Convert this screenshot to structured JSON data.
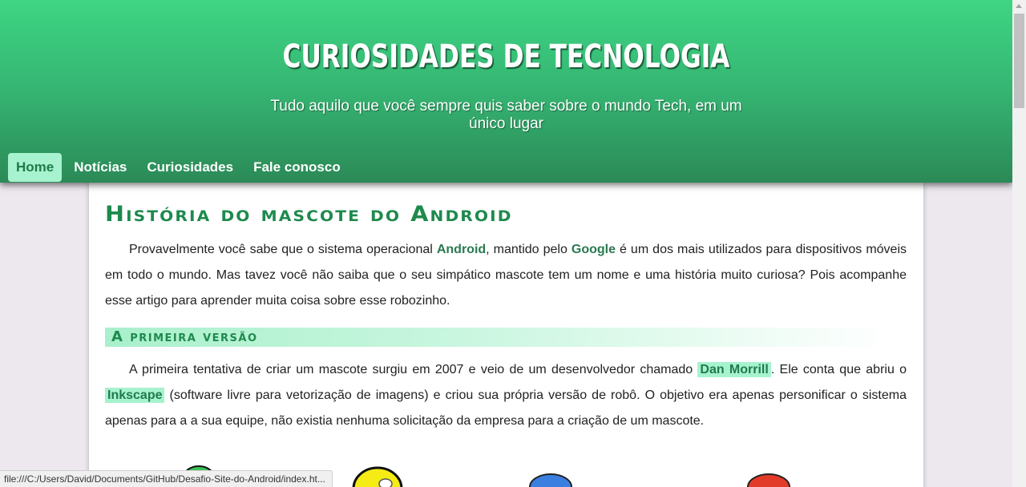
{
  "header": {
    "title": "CURIOSIDADES DE TECNOLOGIA",
    "subtitle": "Tudo aquilo que você sempre quis saber sobre o mundo Tech, em um único lugar"
  },
  "nav": {
    "items": [
      {
        "label": "Home",
        "active": true
      },
      {
        "label": "Notícias",
        "active": false
      },
      {
        "label": "Curiosidades",
        "active": false
      },
      {
        "label": "Fale conosco",
        "active": false
      }
    ]
  },
  "article": {
    "title": "História do mascote do Android",
    "intro": {
      "t1": "Provavelmente você sabe que o sistema operacional ",
      "android": "Android",
      "t2": ", mantido pelo ",
      "google": "Google",
      "t3": " é um dos mais utilizados para dispositivos móveis em todo o mundo. Mas tavez você não saiba que o seu simpático mascote tem um nome e uma história muito curiosa? Pois acompanhe esse artigo para aprender muita coisa sobre esse robozinho."
    },
    "section1": {
      "title": "A primeira versão",
      "t1": "A primeira tentativa de criar um mascote surgiu em 2007 e veio de um desenvolvedor chamado ",
      "dan": "Dan Morrill",
      "t2": ". Ele conta que abriu o ",
      "inkscape": "Inkscape",
      "t3": " (software livre para vetorização de imagens) e criou sua própria versão de robô. O objetivo era apenas personificar o sistema apenas para a a sua equipe, não existia nenhuma solicitação da empresa para a criação de um mascote."
    }
  },
  "status_bar": {
    "url": "file:///C:/Users/David/Documents/GitHub/Desafio-Site-do-Android/index.ht..."
  },
  "colors": {
    "header_top": "#3ed583",
    "header_bottom": "#2b8a57",
    "accent_green": "#1e8a4d",
    "highlight_bg": "#a7f2cf"
  }
}
